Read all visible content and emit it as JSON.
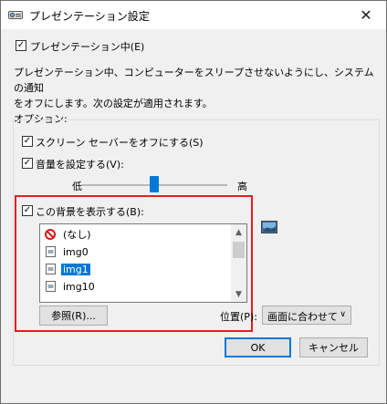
{
  "window": {
    "title": "プレゼンテーション設定",
    "close_glyph": "✕"
  },
  "presenting": {
    "label": "プレゼンテーション中(E)",
    "checked": true
  },
  "description": {
    "line1": "プレゼンテーション中、コンピューターをスリープさせないようにし、システムの通知",
    "line2": "をオフにします。次の設定が適用されます。"
  },
  "options": {
    "group_label": "オプション:",
    "screensaver": {
      "label": "スクリーン セーバーをオフにする(S)",
      "checked": true
    },
    "volume": {
      "label": "音量を設定する(V):",
      "checked": true,
      "low_label": "低",
      "high_label": "高",
      "level": 0.5
    },
    "background": {
      "label": "この背景を表示する(B):",
      "checked": true,
      "items": [
        {
          "label": "(なし)",
          "icon": "no-entry-icon"
        },
        {
          "label": "img0",
          "icon": "image-file-icon"
        },
        {
          "label": "img1",
          "icon": "image-file-icon",
          "selected": true
        },
        {
          "label": "img10",
          "icon": "image-file-icon"
        }
      ],
      "browse_label": "参照(R)...",
      "position_label": "位置(P):",
      "position_value": "画面に合わせて"
    }
  },
  "buttons": {
    "ok": "OK",
    "cancel": "キャンセル"
  },
  "colors": {
    "accent": "#0078d7",
    "highlight_border": "#e02020"
  }
}
